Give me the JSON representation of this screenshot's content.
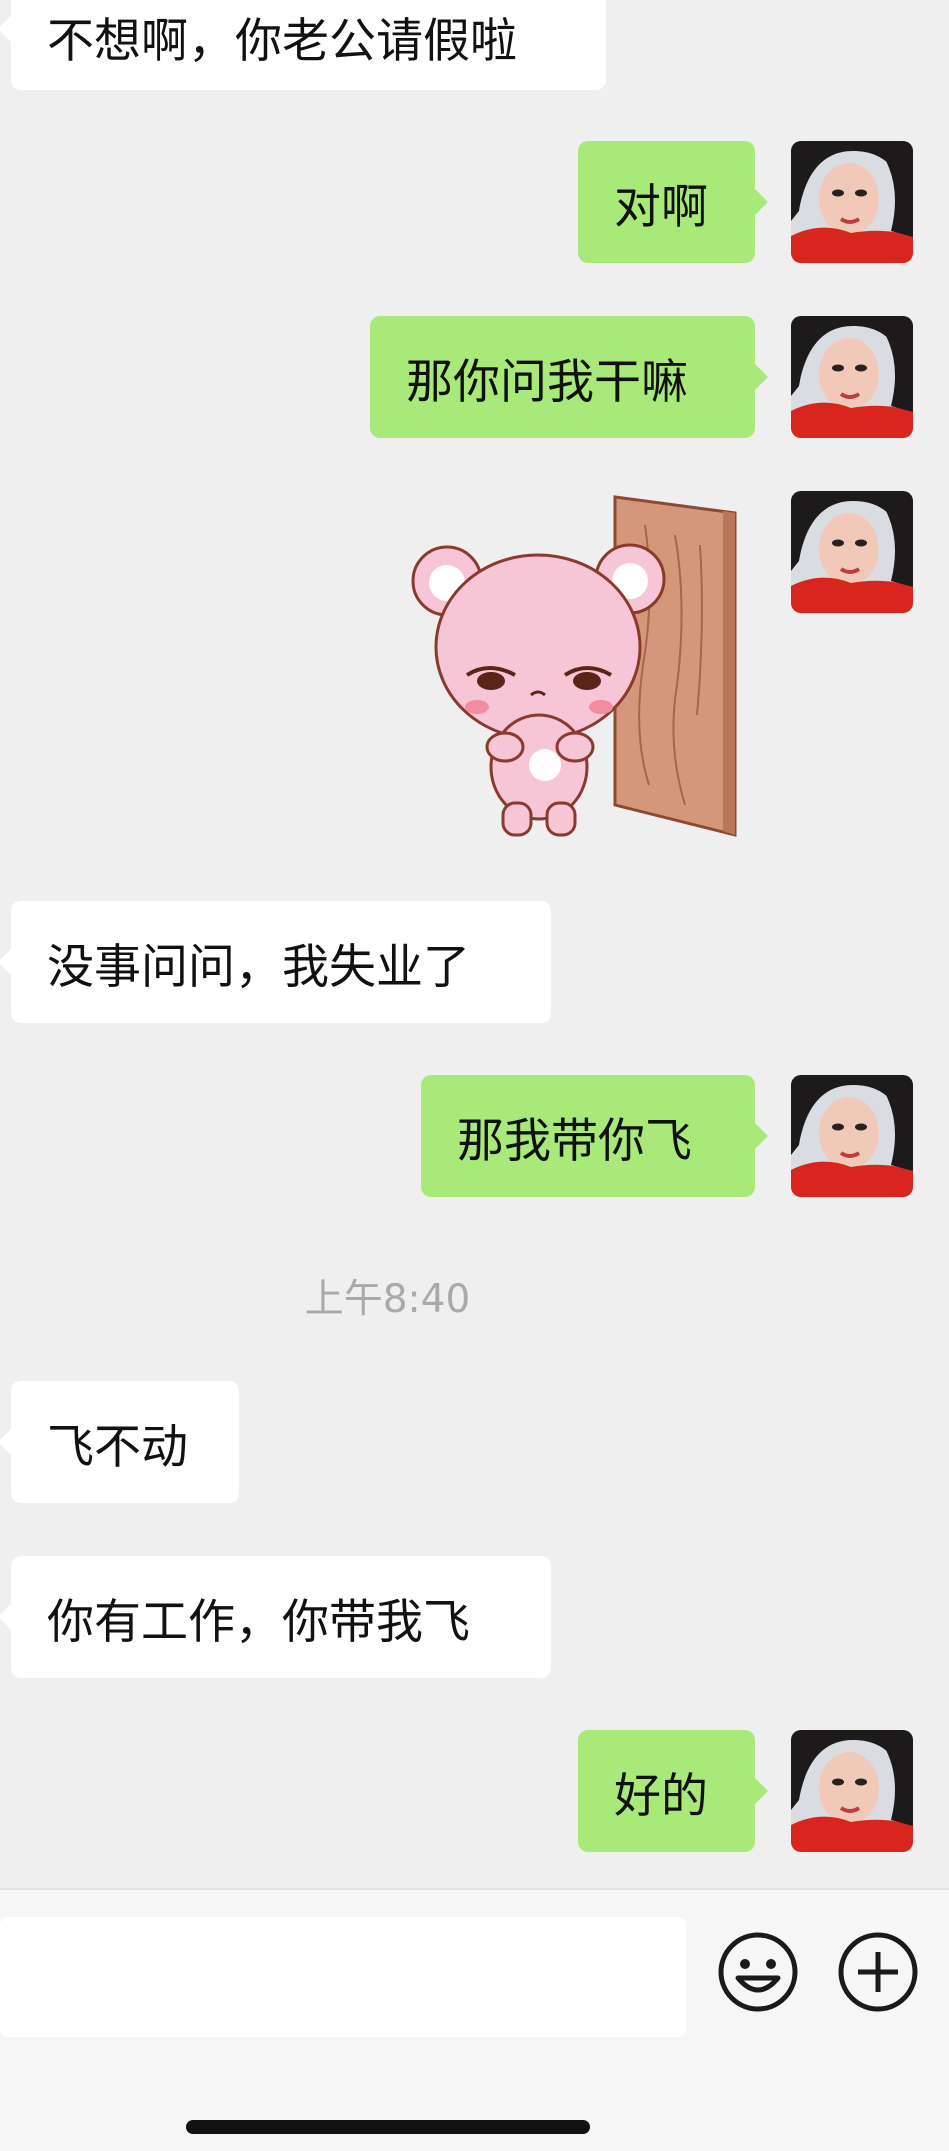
{
  "messages": [
    {
      "side": "incoming",
      "text": "不想啊，你老公请假啦"
    },
    {
      "side": "outgoing",
      "text": "对啊"
    },
    {
      "side": "outgoing",
      "text": "那你问我干嘛"
    },
    {
      "side": "outgoing",
      "type": "sticker",
      "sticker": "pink-bear-peeking-behind-door"
    },
    {
      "side": "incoming",
      "text": "没事问问，我失业了"
    },
    {
      "side": "outgoing",
      "text": "那我带你飞"
    },
    {
      "side": "incoming",
      "text": "飞不动"
    },
    {
      "side": "incoming",
      "text": "你有工作，你带我飞"
    },
    {
      "side": "outgoing",
      "text": "好的"
    }
  ],
  "timestamp": "上午8:40",
  "composer": {
    "input_value": "",
    "emoji_icon": "smiley-face-icon",
    "plus_icon": "plus-circle-icon"
  },
  "colors": {
    "background": "#efefef",
    "outgoing_bubble": "#a9e979",
    "incoming_bubble": "#ffffff",
    "timestamp_text": "#a9a9a9"
  }
}
